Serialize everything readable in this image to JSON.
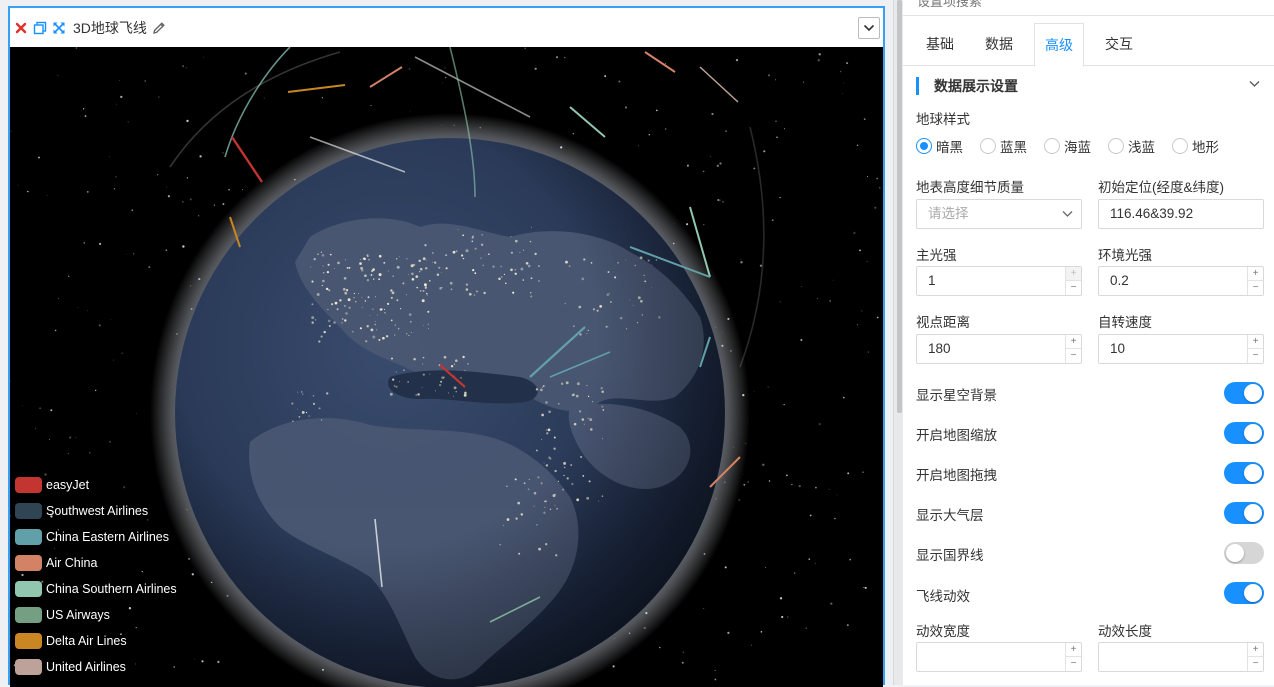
{
  "widget": {
    "title": "3D地球飞线",
    "legend": [
      {
        "label": "easyJet",
        "color": "#c23531"
      },
      {
        "label": "Southwest Airlines",
        "color": "#2f4554"
      },
      {
        "label": "China Eastern Airlines",
        "color": "#61a0a8"
      },
      {
        "label": "Air China",
        "color": "#d48265"
      },
      {
        "label": "China Southern Airlines",
        "color": "#91c7ae"
      },
      {
        "label": "US Airways",
        "color": "#749f83"
      },
      {
        "label": "Delta Air Lines",
        "color": "#ca8622"
      },
      {
        "label": "United Airlines",
        "color": "#bda29a"
      }
    ]
  },
  "settings": {
    "search_placeholder": "设置项搜索",
    "tabs": [
      {
        "label": "基础",
        "active": false
      },
      {
        "label": "数据",
        "active": false
      },
      {
        "label": "高级",
        "active": true
      },
      {
        "label": "交互",
        "active": false
      }
    ],
    "section_title": "数据展示设置",
    "globe_style": {
      "label": "地球样式",
      "options": [
        {
          "label": "暗黑",
          "checked": true
        },
        {
          "label": "蓝黑",
          "checked": false
        },
        {
          "label": "海蓝",
          "checked": false
        },
        {
          "label": "浅蓝",
          "checked": false
        },
        {
          "label": "地形",
          "checked": false
        }
      ]
    },
    "terrain_detail": {
      "label": "地表高度细节质量",
      "placeholder": "请选择"
    },
    "initial_position": {
      "label": "初始定位(经度&纬度)",
      "value": "116.46&39.92"
    },
    "main_light": {
      "label": "主光强",
      "value": "1"
    },
    "ambient_light": {
      "label": "环境光强",
      "value": "0.2"
    },
    "view_distance": {
      "label": "视点距离",
      "value": "180"
    },
    "rotation_speed": {
      "label": "自转速度",
      "value": "10"
    },
    "toggles": [
      {
        "label": "显示星空背景",
        "on": true
      },
      {
        "label": "开启地图缩放",
        "on": true
      },
      {
        "label": "开启地图拖拽",
        "on": true
      },
      {
        "label": "显示大气层",
        "on": true
      },
      {
        "label": "显示国界线",
        "on": false
      },
      {
        "label": "飞线动效",
        "on": true
      }
    ],
    "effect_width": {
      "label": "动效宽度",
      "value": ""
    },
    "effect_length": {
      "label": "动效长度",
      "value": ""
    },
    "colors": {
      "accent": "#1890ff",
      "widget_border": "#35a0f5"
    }
  }
}
